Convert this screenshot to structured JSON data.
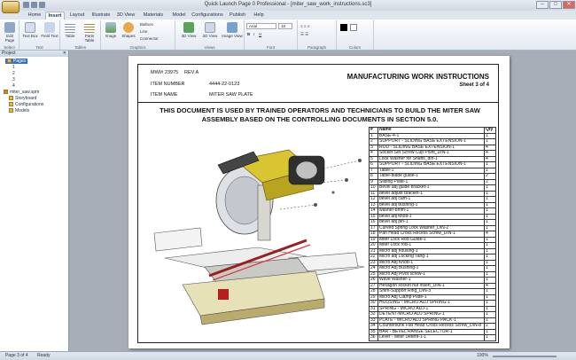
{
  "window": {
    "title": "Quick Launch Page 0 Professional - [miter_saw_work_instructions.sc3]",
    "minimize": "–",
    "maximize": "□",
    "close": "✕"
  },
  "tabs": [
    "Home",
    "Insert",
    "Layout",
    "Illustrate",
    "3D View",
    "Materials",
    "Model",
    "Configurations",
    "Publish",
    "Help"
  ],
  "active_tab": "Insert",
  "ribbon": {
    "groups": [
      "Select",
      "Text",
      "Tables",
      "Graphics",
      "Views",
      "Font",
      "Paragraph",
      "Colors"
    ],
    "buttons": {
      "edit_page": "Edit Page",
      "text_box": "Text Box",
      "field_text": "Field Text",
      "table": "Table",
      "parts_table": "Parts Table",
      "image": "Image",
      "shapes": "Shapes",
      "balloon": "Balloon",
      "line": "Line",
      "connector": "Connector",
      "view_3d": "3D View",
      "view_2d": "2D View",
      "image_view": "Image View"
    },
    "font_name": "Arial",
    "font_size": "18"
  },
  "panel": {
    "title": "Project",
    "tree": [
      "Pages",
      "1",
      "2",
      "3",
      "4",
      "miter_saw.spm",
      "Storyboard",
      "Configurations",
      "Models"
    ]
  },
  "document": {
    "mwi": "MWI# 23975",
    "rev": "REV A",
    "item_number_label": "ITEM NUMBER",
    "item_number": "4444-22-0123",
    "item_name_label": "ITEM NAME",
    "item_name": "MITER SAW PLATE",
    "title": "MANUFACTURING WORK INSTRUCTIONS",
    "sheet": "Sheet 3 of 4",
    "notice": "THIS DOCUMENT IS USED BY TRAINED OPERATORS AND TECHNICIANS TO BUILD THE MITER SAW ASSEMBLY BASED ON THE CONTROLLING DOCUMENTS IN SECTION 5.0."
  },
  "bom": {
    "headers": [
      "#",
      "Name",
      "Qty"
    ],
    "rows": [
      [
        "1",
        "BASE-4-1",
        "1"
      ],
      [
        "2",
        "SUPPORT - SLIDING BASE EXTENSION-1",
        "1"
      ],
      [
        "3",
        "ROD - SLIDING BASE EXTENSION-1",
        "4"
      ],
      [
        "4",
        "Socket Set Screw Cup Point_DIN-1",
        "4"
      ],
      [
        "5",
        "Lock Washer for Shafts_din-1",
        "4"
      ],
      [
        "6",
        "SUPPORT - SLIDING BASE EXTENSION-1",
        "1"
      ],
      [
        "7",
        "Table-1",
        "1"
      ],
      [
        "8",
        "Table-blade guide-1",
        "2"
      ],
      [
        "9",
        "Sliding Plate-1",
        "2"
      ],
      [
        "10",
        "Bevel adj guide bracket-1",
        "1"
      ],
      [
        "11",
        "bevel adjust bracket-1",
        "1"
      ],
      [
        "12",
        "bevel adj cam-1",
        "1"
      ],
      [
        "13",
        "bevel adj bushing-1",
        "1"
      ],
      [
        "14",
        "washer-8mm-1",
        "1"
      ],
      [
        "15",
        "bevel adj knob-1",
        "1"
      ],
      [
        "16",
        "bevel adj pin-1",
        "1"
      ],
      [
        "17",
        "Curved Spring Lock Washer_DIN-2",
        "1"
      ],
      [
        "18",
        "Pan Head Cross Recess Screw_DIN-1",
        "4"
      ],
      [
        "19",
        "Miter Lock Rod Guide-1",
        "1"
      ],
      [
        "20",
        "Miter Lock rod-1",
        "1"
      ],
      [
        "21",
        "Micro adj housing-1",
        "1"
      ],
      [
        "22",
        "Micro adj Locking Tang-1",
        "1"
      ],
      [
        "23",
        "Micro Adj Knob-1",
        "1"
      ],
      [
        "24",
        "Micro Adj Bushing-1",
        "1"
      ],
      [
        "25",
        "Micro Adj Pivot screw-1",
        "1"
      ],
      [
        "26",
        "Wave Washer-1",
        "1"
      ],
      [
        "27",
        "Hexagon socket nut insert_DIN-1",
        "4"
      ],
      [
        "28",
        "Shim-Support Ring_DIN-3",
        "1"
      ],
      [
        "29",
        "Micro Adj Clamp Plate-1",
        "1"
      ],
      [
        "30",
        "HOUSING - MICRO ADJ SPRING-1",
        "1"
      ],
      [
        "31",
        "SPRING - MICRO ADJ-1",
        "1"
      ],
      [
        "32",
        "DETENT-MICRO ADJ SPRING-1",
        "1"
      ],
      [
        "33",
        "PLATE - MICRO ADJ SPRING PACK-1",
        "1"
      ],
      [
        "34",
        "Countersunk Flat Head Cross Recess Screw_DIN-8",
        "2"
      ],
      [
        "35",
        "BAR - BEVEL RANGE SELECTOR-1",
        "1"
      ],
      [
        "36",
        "Lever - Miter Detent-1-1",
        "1"
      ]
    ]
  },
  "status": {
    "page": "Page 3 of 4",
    "state": "Ready",
    "zoom": "100%"
  }
}
